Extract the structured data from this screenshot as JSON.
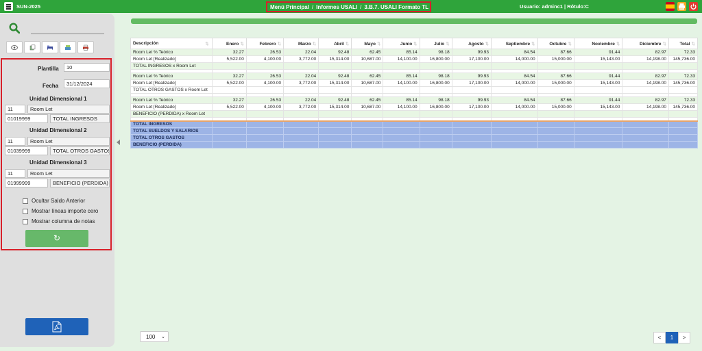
{
  "topbar": {
    "app_name": "SUN-2025",
    "breadcrumb": [
      "Menú Principal",
      "Informes USALI",
      "3.B.7. USALI Formato TL"
    ],
    "breadcrumb_sep": "/",
    "user_info": "Usuario: adminc1 | Rótulo:C",
    "icons": [
      "spain-flag-icon",
      "print-icon",
      "power-icon"
    ]
  },
  "sidebar": {
    "plantilla_label": "Plantilla",
    "plantilla_value": "10",
    "fecha_label": "Fecha",
    "fecha_value": "31/12/2024",
    "dims": [
      {
        "title": "Unidad Dimensional 1",
        "code": "11",
        "name": "Room Let",
        "account": "01019999",
        "account_name": "TOTAL INGRESOS"
      },
      {
        "title": "Unidad Dimensional 2",
        "code": "11",
        "name": "Room Let",
        "account": "01039999",
        "account_name": "TOTAL OTROS GASTOS"
      },
      {
        "title": "Unidad Dimensional 3",
        "code": "11",
        "name": "Room Let",
        "account": "01999999",
        "account_name": "BENEFICIO (PERDIDA)"
      }
    ],
    "options": [
      "Ocultar Saldo Anterior",
      "Mostrar líneas importe cero",
      "Mostrar columna de notas"
    ],
    "refresh_icon": "↻"
  },
  "table": {
    "headers": [
      "Descripción",
      "Enero",
      "Febrero",
      "Marzo",
      "Abril",
      "Mayo",
      "Junio",
      "Julio",
      "Agosto",
      "Septiembre",
      "Octubre",
      "Noviembre",
      "Diciembre",
      "Total"
    ],
    "rows": [
      {
        "kind": "teo",
        "cells": [
          "Room Let % Teórico",
          "32.27",
          "26.53",
          "22.04",
          "92.48",
          "62.45",
          "85.14",
          "98.18",
          "99.93",
          "84.54",
          "87.66",
          "91.44",
          "82.97",
          "72.33"
        ]
      },
      {
        "kind": "real",
        "cells": [
          "Room Let [Realizado]",
          "5,522.00",
          "4,100.00",
          "3,772.00",
          "15,314.00",
          "10,687.00",
          "14,100.00",
          "16,800.00",
          "17,100.00",
          "14,000.00",
          "15,000.00",
          "15,143.00",
          "14,198.00",
          "145,736.00"
        ]
      },
      {
        "kind": "teo",
        "cells": [
          "TOTAL INGRESOS x Room Let",
          "",
          "",
          "",
          "",
          "",
          "",
          "",
          "",
          "",
          "",
          "",
          "",
          ""
        ]
      },
      {
        "kind": "spacer",
        "cells": []
      },
      {
        "kind": "teo",
        "cells": [
          "Room Let % Teórico",
          "32.27",
          "26.53",
          "22.04",
          "92.48",
          "62.45",
          "85.14",
          "98.18",
          "99.93",
          "84.54",
          "87.66",
          "91.44",
          "82.97",
          "72.33"
        ]
      },
      {
        "kind": "real",
        "cells": [
          "Room Let [Realizado]",
          "5,522.00",
          "4,100.00",
          "3,772.00",
          "15,314.00",
          "10,687.00",
          "14,100.00",
          "16,800.00",
          "17,100.00",
          "14,000.00",
          "15,000.00",
          "15,143.00",
          "14,198.00",
          "145,736.00"
        ]
      },
      {
        "kind": "real",
        "cells": [
          "TOTAL OTROS GASTOS x Room Let",
          "",
          "",
          "",
          "",
          "",
          "",
          "",
          "",
          "",
          "",
          "",
          "",
          ""
        ]
      },
      {
        "kind": "spacer",
        "cells": []
      },
      {
        "kind": "teo",
        "cells": [
          "Room Let % Teórico",
          "32.27",
          "26.53",
          "22.04",
          "92.48",
          "62.45",
          "85.14",
          "98.18",
          "99.93",
          "84.54",
          "87.66",
          "91.44",
          "82.97",
          "72.33"
        ]
      },
      {
        "kind": "real",
        "cells": [
          "Room Let [Realizado]",
          "5,522.00",
          "4,100.00",
          "3,772.00",
          "15,314.00",
          "10,687.00",
          "14,100.00",
          "16,800.00",
          "17,100.00",
          "14,000.00",
          "15,000.00",
          "15,143.00",
          "14,198.00",
          "145,736.00"
        ]
      },
      {
        "kind": "teo",
        "cells": [
          "BENEFICIO (PERDIDA) x Room Let",
          "",
          "",
          "",
          "",
          "",
          "",
          "",
          "",
          "",
          "",
          "",
          "",
          ""
        ]
      },
      {
        "kind": "spacer",
        "cells": []
      },
      {
        "kind": "summary",
        "cells": [
          "TOTAL INGRESOS",
          "",
          "",
          "",
          "",
          "",
          "",
          "",
          "",
          "",
          "",
          "",
          "",
          ""
        ]
      },
      {
        "kind": "summary",
        "cells": [
          "TOTAL SUELDOS Y SALARIOS",
          "",
          "",
          "",
          "",
          "",
          "",
          "",
          "",
          "",
          "",
          "",
          "",
          ""
        ]
      },
      {
        "kind": "summary",
        "cells": [
          "TOTAL OTROS GASTOS",
          "",
          "",
          "",
          "",
          "",
          "",
          "",
          "",
          "",
          "",
          "",
          "",
          ""
        ]
      },
      {
        "kind": "summary",
        "cells": [
          "BENEFICIO (PERDIDA)",
          "",
          "",
          "",
          "",
          "",
          "",
          "",
          "",
          "",
          "",
          "",
          "",
          ""
        ]
      }
    ]
  },
  "footer": {
    "page_size": "100",
    "pager": [
      "<",
      "1",
      ">"
    ]
  },
  "colors": {
    "topbar": "#2fa43b",
    "highlight_border": "#d8202a",
    "summary_row": "#9db4e6",
    "primary_button": "#1f62b8",
    "refresh_button": "#67b86a"
  }
}
